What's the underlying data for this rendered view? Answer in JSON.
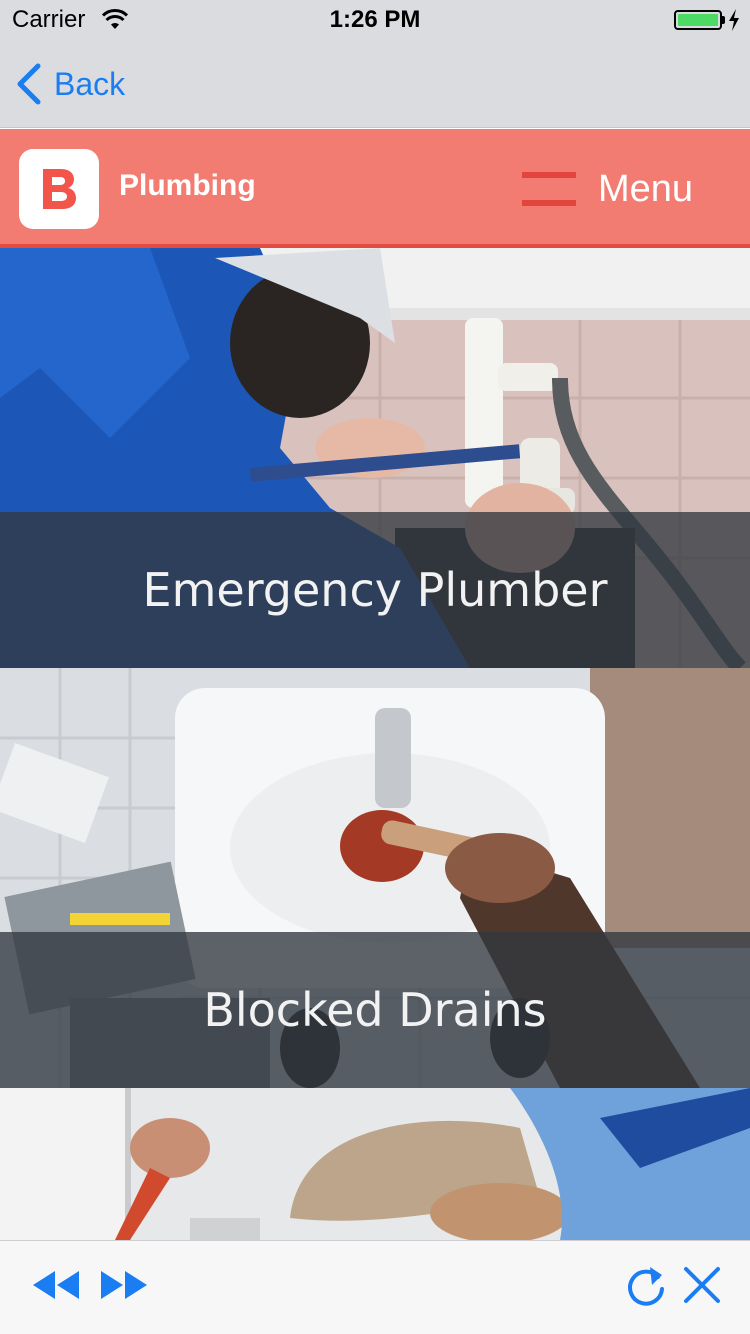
{
  "status_bar": {
    "carrier": "Carrier",
    "time": "1:26 PM",
    "battery_level": 1.0,
    "battery_color": "#4cd964"
  },
  "nav": {
    "back_label": "Back",
    "back_icon": "chevron-left-icon"
  },
  "header": {
    "logo_letter": "B",
    "title": "Plumbing",
    "menu_label": "Menu",
    "brand_color": "#f37c72",
    "accent_color": "#e34a40"
  },
  "tiles": [
    {
      "label": "Emergency Plumber"
    },
    {
      "label": "Blocked Drains"
    },
    {
      "label": ""
    }
  ],
  "toolbar": {
    "icons": [
      "rewind-icon",
      "fast-forward-icon",
      "refresh-icon",
      "close-icon"
    ],
    "tint": "#1a7ef2"
  }
}
